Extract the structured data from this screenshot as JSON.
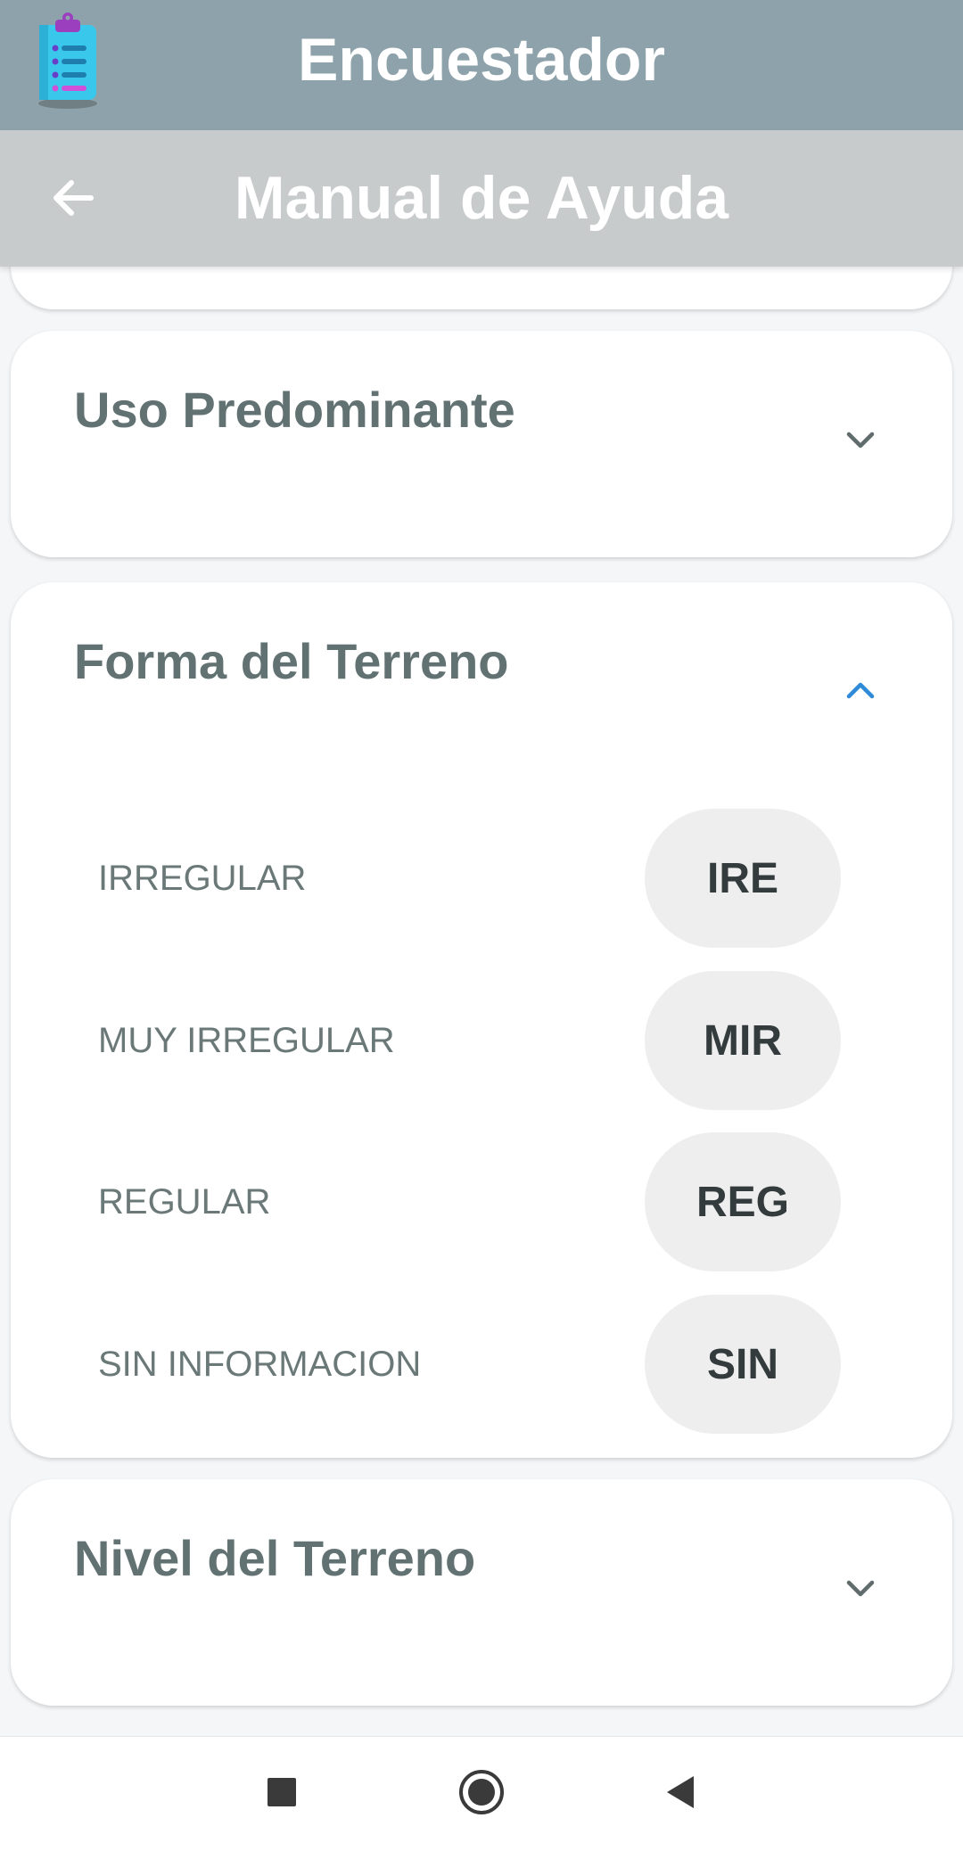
{
  "app": {
    "title": "Encuestador",
    "icon": "clipboard-list-icon"
  },
  "header": {
    "title": "Manual de Ayuda",
    "back_icon": "arrow-left-icon"
  },
  "sections": [
    {
      "title": "Uso Predominante",
      "expanded": false,
      "icon": "chevron-down-icon"
    },
    {
      "title": "Forma del Terreno",
      "expanded": true,
      "icon": "chevron-up-icon",
      "accent": "#2f8ad8",
      "options": [
        {
          "label": "IRREGULAR",
          "code": "IRE"
        },
        {
          "label": "MUY IRREGULAR",
          "code": "MIR"
        },
        {
          "label": "REGULAR",
          "code": "REG"
        },
        {
          "label": "SIN INFORMACION",
          "code": "SIN"
        }
      ]
    },
    {
      "title": "Nivel del Terreno",
      "expanded": false,
      "icon": "chevron-down-icon"
    }
  ],
  "system_nav": {
    "buttons": [
      "recents-square-icon",
      "home-circle-icon",
      "back-triangle-icon"
    ]
  },
  "colors": {
    "app_bar": "#8ea2ab",
    "sub_bar": "#c8cbcb",
    "background": "#f4f6f8",
    "card_title": "#627273",
    "chip_bg": "#eeeeee",
    "chip_text": "#333b3c",
    "accent": "#2f8ad8"
  }
}
